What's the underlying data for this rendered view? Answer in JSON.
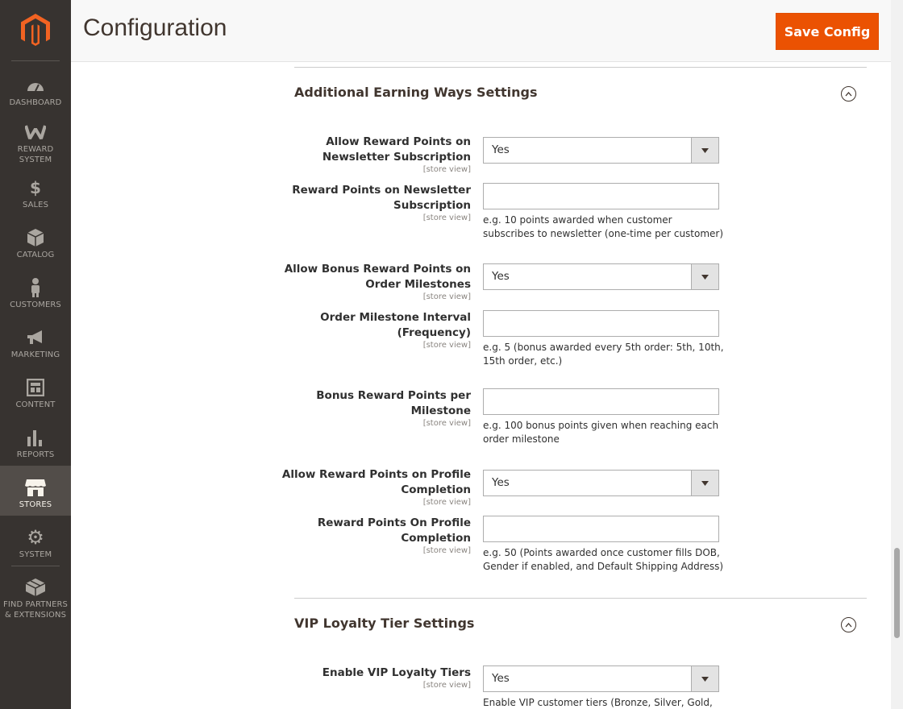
{
  "header": {
    "title": "Configuration",
    "save_label": "Save Config"
  },
  "sidebar": {
    "items": [
      {
        "label": "DASHBOARD",
        "icon": "dashboard-icon"
      },
      {
        "label": "REWARD SYSTEM",
        "icon": "reward-icon"
      },
      {
        "label": "SALES",
        "icon": "dollar-icon"
      },
      {
        "label": "CATALOG",
        "icon": "box-icon"
      },
      {
        "label": "CUSTOMERS",
        "icon": "person-icon"
      },
      {
        "label": "MARKETING",
        "icon": "megaphone-icon"
      },
      {
        "label": "CONTENT",
        "icon": "layout-icon"
      },
      {
        "label": "REPORTS",
        "icon": "bar-chart-icon"
      },
      {
        "label": "STORES",
        "icon": "store-icon",
        "active": true
      },
      {
        "label": "SYSTEM",
        "icon": "gear-icon"
      },
      {
        "label": "FIND PARTNERS & EXTENSIONS",
        "icon": "blocks-icon"
      }
    ]
  },
  "sections": {
    "earning": {
      "title": "Additional Earning Ways Settings",
      "fields": {
        "newsletter_allow": {
          "label": "Allow Reward Points on Newsletter Subscription",
          "scope": "[store view]",
          "value": "Yes"
        },
        "newsletter_points": {
          "label": "Reward Points on Newsletter Subscription",
          "scope": "[store view]",
          "value": "",
          "note": "e.g. 10 points awarded when customer subscribes to newsletter (one-time per customer)"
        },
        "milestone_allow": {
          "label": "Allow Bonus Reward Points on Order Milestones",
          "scope": "[store view]",
          "value": "Yes"
        },
        "milestone_interval": {
          "label": "Order Milestone Interval (Frequency)",
          "scope": "[store view]",
          "value": "",
          "note": "e.g. 5 (bonus awarded every 5th order: 5th, 10th, 15th order, etc.)"
        },
        "milestone_points": {
          "label": "Bonus Reward Points per Milestone",
          "scope": "[store view]",
          "value": "",
          "note": "e.g. 100 bonus points given when reaching each order milestone"
        },
        "profile_allow": {
          "label": "Allow Reward Points on Profile Completion",
          "scope": "[store view]",
          "value": "Yes"
        },
        "profile_points": {
          "label": "Reward Points On Profile Completion",
          "scope": "[store view]",
          "value": "",
          "note": "e.g. 50 (Points awarded once customer fills DOB, Gender if enabled, and Default Shipping Address)"
        }
      }
    },
    "vip": {
      "title": "VIP Loyalty Tier Settings",
      "fields": {
        "vip_enable": {
          "label": "Enable VIP Loyalty Tiers",
          "scope": "[store view]",
          "value": "Yes",
          "note": "Enable VIP customer tiers (Bronze, Silver, Gold, etc.)"
        }
      }
    }
  },
  "colors": {
    "accent": "#eb5202",
    "sidebar": "#373330",
    "sidebar_active": "#524d49"
  }
}
